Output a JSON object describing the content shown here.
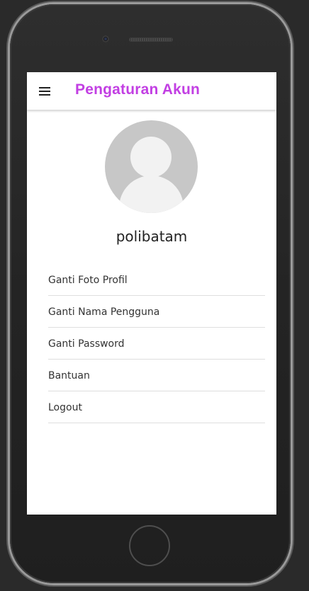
{
  "app_bar": {
    "title": "Pengaturan Akun",
    "menu_icon": "hamburger-menu-icon",
    "title_color": "#c23fe3"
  },
  "profile": {
    "avatar_icon": "default-user-avatar-icon",
    "username": "polibatam"
  },
  "menu": {
    "items": [
      {
        "label": "Ganti Foto Profil"
      },
      {
        "label": "Ganti Nama Pengguna"
      },
      {
        "label": "Ganti Password"
      },
      {
        "label": "Bantuan"
      },
      {
        "label": "Logout"
      }
    ]
  },
  "device": {
    "home_button_icon": "home-button-icon"
  }
}
